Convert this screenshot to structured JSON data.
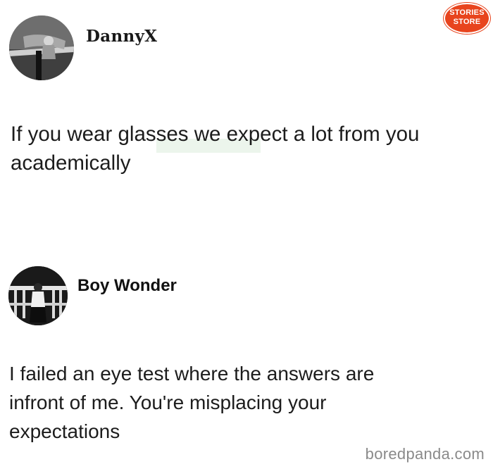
{
  "logo": {
    "line1": "STORIES",
    "line2": "STORE",
    "color": "#e8441d"
  },
  "tweets": [
    {
      "username": "DannyX",
      "avatar_icon": "profile-photo",
      "text_lines": [
        "If you wear glasses we expect a lot from you",
        "academically"
      ]
    },
    {
      "username": "Boy Wonder",
      "avatar_icon": "profile-photo",
      "text_lines": [
        "I failed an eye test where the answers are",
        "infront of me. You're misplacing your",
        "expectations"
      ]
    }
  ],
  "watermark": "boredpanda.com"
}
